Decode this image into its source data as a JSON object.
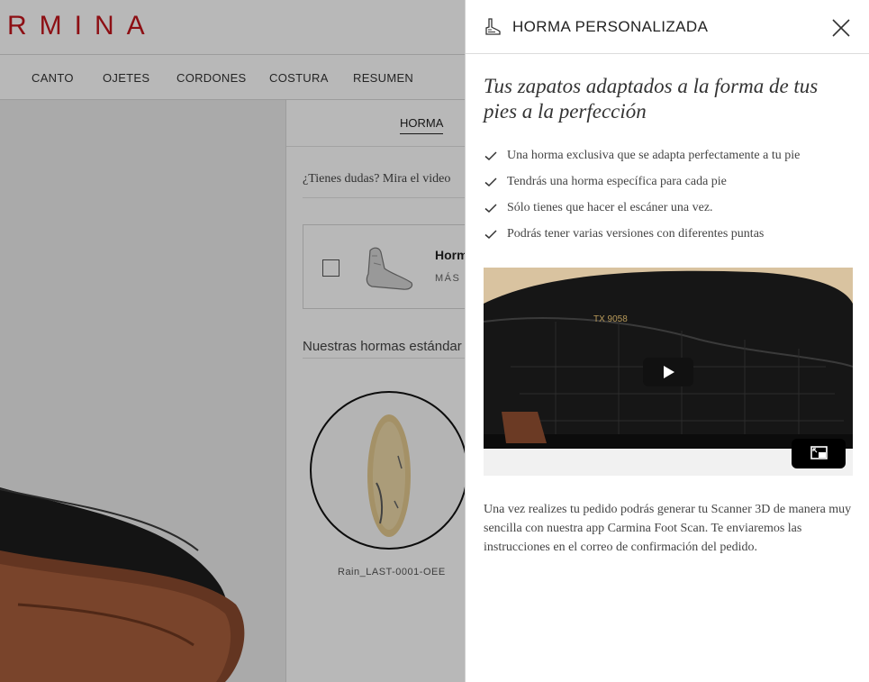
{
  "brand": {
    "name": "RMINA",
    "color": "#c4161c"
  },
  "nav": {
    "items": [
      "CANTO",
      "OJETES",
      "CORDONES",
      "COSTURA",
      "RESUMEN"
    ]
  },
  "config": {
    "active_tab": "HORMA",
    "doubt_text": "¿Tienes dudas? Mira el video",
    "option": {
      "title": "Horm",
      "more": "MÁS I",
      "checked": false,
      "thumb_icon": "foot-last-icon"
    },
    "standard_title": "Nuestras hormas estándar",
    "last": {
      "name": "Rain_LAST-0001-OEE"
    }
  },
  "panel": {
    "icon": "foot-last-icon",
    "title": "HORMA PERSONALIZADA",
    "close_icon": "close-icon",
    "tagline": "Tus zapatos adaptados a la forma de tus pies a la perfección",
    "benefits": [
      "Una horma exclusiva que se adapta perfectamente a tu pie",
      "Tendrás una horma específica para cada pie",
      "Sólo tienes que hacer el escáner una vez.",
      "Podrás tener varias versiones con diferentes puntas"
    ],
    "video": {
      "stamp": "TX 9058",
      "play_icon": "play-icon",
      "pip_icon": "picture-in-picture-icon"
    },
    "info": "Una vez realizes tu pedido podrás generar tu Scanner 3D de manera muy sencilla con nuestra app Carmina Foot Scan. Te enviaremos las instrucciones en el correo de confirmación del pedido."
  }
}
